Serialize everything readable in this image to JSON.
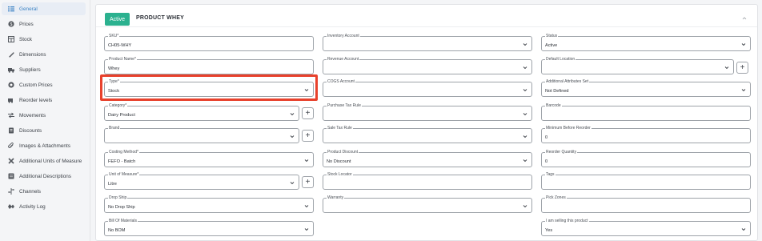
{
  "sidebar": {
    "items": [
      {
        "label": "General",
        "icon": "general-icon",
        "active": true
      },
      {
        "label": "Prices",
        "icon": "prices-icon"
      },
      {
        "label": "Stock",
        "icon": "stock-icon"
      },
      {
        "label": "Dimensions",
        "icon": "ruler-icon"
      },
      {
        "label": "Suppliers",
        "icon": "truck-icon"
      },
      {
        "label": "Custom Prices",
        "icon": "custom-prices-icon"
      },
      {
        "label": "Reorder levels",
        "icon": "reorder-icon"
      },
      {
        "label": "Movements",
        "icon": "arrows-icon"
      },
      {
        "label": "Discounts",
        "icon": "discount-icon"
      },
      {
        "label": "Images & Attachments",
        "icon": "paperclip-icon"
      },
      {
        "label": "Additional Units of Measure",
        "icon": "scale-icon"
      },
      {
        "label": "Additional Descriptions",
        "icon": "description-icon"
      },
      {
        "label": "Channels",
        "icon": "channels-icon"
      },
      {
        "label": "Activity Log",
        "icon": "activity-icon"
      }
    ]
  },
  "header": {
    "status_badge": "Active",
    "title": "PRODUCT WHEY"
  },
  "form": {
    "sku": {
      "label": "SKU*",
      "value": "CH05-WHY"
    },
    "product_name": {
      "label": "Product Name*",
      "value": "Whey"
    },
    "type": {
      "label": "Type*",
      "value": "Stock"
    },
    "category": {
      "label": "Category*",
      "value": "Dairy Product"
    },
    "brand": {
      "label": "Brand",
      "value": ""
    },
    "costing_method": {
      "label": "Costing Method*",
      "value": "FEFO - Batch"
    },
    "unit_of_measure": {
      "label": "Unit of Measure*",
      "value": "Litre"
    },
    "drop_ship": {
      "label": "Drop Ship",
      "value": "No Drop Ship"
    },
    "bill_of_materials": {
      "label": "Bill Of Materials",
      "value": "No BOM"
    },
    "inventory_account": {
      "label": "Inventory Account",
      "value": ""
    },
    "revenue_account": {
      "label": "Revenue Account",
      "value": ""
    },
    "cogs_account": {
      "label": "COGS Account",
      "value": ""
    },
    "purchase_tax_rule": {
      "label": "Purchase Tax Rule",
      "value": ""
    },
    "sale_tax_rule": {
      "label": "Sale Tax Rule",
      "value": ""
    },
    "product_discount": {
      "label": "Product Discount",
      "value": "No Discount"
    },
    "stock_locator": {
      "label": "Stock Locator",
      "value": ""
    },
    "warranty": {
      "label": "Warranty",
      "value": ""
    },
    "status": {
      "label": "Status",
      "value": "Active"
    },
    "default_location": {
      "label": "Default Location",
      "value": ""
    },
    "additional_attributes_set": {
      "label": "Additional Attributes Set",
      "value": "Not Defined"
    },
    "barcode": {
      "label": "Barcode",
      "value": ""
    },
    "minimum_before_reorder": {
      "label": "Minimum Before Reorder",
      "value": "0"
    },
    "reorder_quantity": {
      "label": "Reorder Quantity",
      "value": "0"
    },
    "tags": {
      "label": "Tags",
      "value": ""
    },
    "pick_zones": {
      "label": "Pick Zones",
      "value": ""
    },
    "selling": {
      "label": "I am selling this product",
      "value": "Yes"
    }
  },
  "colors": {
    "accent": "#2bb18f",
    "active_nav": "#3b82c4",
    "highlight": "#e8412c"
  }
}
